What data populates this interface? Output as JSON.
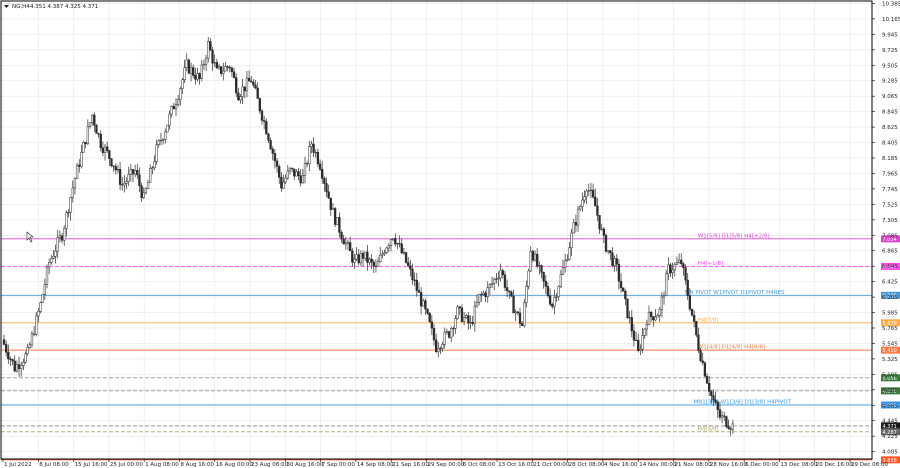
{
  "header": {
    "symbol": "NG,H4",
    "ohlc": "4.351 4.387 4.325 4.371"
  },
  "colors": {
    "candle": "#2b2b2b",
    "grid": "#e6e6e6",
    "frame": "#000000",
    "price_tag": "#1a1a1a"
  },
  "chart_data": {
    "type": "candlestick",
    "title": "",
    "ylim": [
      3.9,
      10.42
    ],
    "grid": true,
    "yticks": [
      "10.385",
      "10.165",
      "9.945",
      "9.725",
      "9.505",
      "9.285",
      "9.065",
      "8.845",
      "8.625",
      "8.405",
      "8.185",
      "7.965",
      "7.745",
      "7.525",
      "7.305",
      "7.085",
      "6.865",
      "6.645",
      "6.425",
      "6.205",
      "5.985",
      "5.765",
      "5.545",
      "5.325",
      "5.105",
      "4.885",
      "4.665",
      "4.445",
      "4.225",
      "4.005"
    ],
    "xticks": [
      "1 Jul 2022",
      "8 Jul 08:00",
      "15 Jul 16:00",
      "25 Jul 00:00",
      "1 Aug 08:00",
      "8 Aug 16:00",
      "16 Aug 00:00",
      "23 Aug 08:00",
      "30 Aug 16:00",
      "7 Sep 00:00",
      "14 Sep 08:00",
      "21 Sep 16:00",
      "29 Sep 00:00",
      "6 Oct 08:00",
      "13 Oct 16:00",
      "21 Oct 00:00",
      "28 Oct 08:00",
      "4 Nov 16:00",
      "14 Nov 00:00",
      "21 Nov 08:00",
      "28 Nov 16:00",
      "6 Dec 00:00",
      "13 Dec 08:00",
      "20 Dec 16:00",
      "29 Dec 08:00"
    ],
    "close_path": [
      [
        0,
        5.6
      ],
      [
        3,
        5.2
      ],
      [
        6,
        5.4
      ],
      [
        9,
        6.1
      ],
      [
        11,
        6.7
      ],
      [
        14,
        7.1
      ],
      [
        17,
        7.9
      ],
      [
        21,
        8.8
      ],
      [
        23,
        8.4
      ],
      [
        26,
        8.1
      ],
      [
        28,
        7.8
      ],
      [
        31,
        8.0
      ],
      [
        33,
        7.6
      ],
      [
        36,
        8.3
      ],
      [
        38,
        8.6
      ],
      [
        41,
        9.1
      ],
      [
        43,
        9.5
      ],
      [
        46,
        9.3
      ],
      [
        48,
        9.8
      ],
      [
        50,
        9.4
      ],
      [
        53,
        9.5
      ],
      [
        55,
        9.1
      ],
      [
        58,
        9.3
      ],
      [
        60,
        8.9
      ],
      [
        62,
        8.5
      ],
      [
        65,
        7.8
      ],
      [
        67,
        8.0
      ],
      [
        70,
        7.9
      ],
      [
        72,
        8.4
      ],
      [
        74,
        8.1
      ],
      [
        77,
        7.4
      ],
      [
        79,
        7.1
      ],
      [
        82,
        6.7
      ],
      [
        84,
        6.8
      ],
      [
        87,
        6.6
      ],
      [
        89,
        6.9
      ],
      [
        91,
        7.1
      ],
      [
        94,
        6.7
      ],
      [
        96,
        6.4
      ],
      [
        99,
        5.9
      ],
      [
        101,
        5.5
      ],
      [
        104,
        5.7
      ],
      [
        106,
        6.0
      ],
      [
        109,
        5.8
      ],
      [
        111,
        6.2
      ],
      [
        113,
        6.3
      ],
      [
        116,
        6.6
      ],
      [
        118,
        6.2
      ],
      [
        121,
        5.8
      ],
      [
        123,
        6.9
      ],
      [
        126,
        6.4
      ],
      [
        128,
        6.1
      ],
      [
        131,
        6.7
      ],
      [
        133,
        7.2
      ],
      [
        136,
        7.8
      ],
      [
        138,
        7.5
      ],
      [
        140,
        7.0
      ],
      [
        143,
        6.6
      ],
      [
        145,
        6.1
      ],
      [
        148,
        5.4
      ],
      [
        150,
        5.9
      ],
      [
        153,
        6.0
      ],
      [
        155,
        6.6
      ],
      [
        158,
        6.7
      ],
      [
        160,
        6.1
      ],
      [
        162,
        5.5
      ],
      [
        165,
        4.8
      ],
      [
        167,
        4.5
      ],
      [
        170,
        4.37
      ]
    ],
    "levels": [
      {
        "label": "W1[5/8] D1[5/8] H4[+2/8]",
        "price": "7.034",
        "value": 7.034,
        "color": "#dd44cc",
        "dash": false,
        "label_x": 0.8
      },
      {
        "label": "H4[+1/8]",
        "price": "6.641",
        "value": 6.641,
        "color": "#ff44ee",
        "dash": true,
        "label_x": 0.8
      },
      {
        "label": "MN PIVOT W1PIVOT D1PIVOT H4RES",
        "price": "6.230",
        "value": 6.23,
        "color": "#4499dd",
        "dash": false,
        "label_x": 0.785
      },
      {
        "label": "H4[7/8]",
        "price": "5.839",
        "value": 5.839,
        "color": "#ffaa44",
        "dash": false,
        "label_x": 0.8
      },
      {
        "label": "W1[4/8] D1[4/8] H4[6/8]",
        "price": "5.450",
        "value": 5.45,
        "color": "#ff7744",
        "dash": false,
        "label_x": 0.8
      },
      {
        "label": "",
        "price": "5.056",
        "value": 5.056,
        "color": "#999999",
        "dash": true,
        "label_x": 0
      },
      {
        "label": "",
        "price": "4.870",
        "value": 4.87,
        "color": "#999999",
        "dash": true,
        "label_x": 0
      },
      {
        "label": "MN1[3/8] W1[3/8] D1[3/8] H4PIVOT",
        "price": "4.669",
        "value": 4.669,
        "color": "#3399ee",
        "dash": false,
        "label_x": 0.795
      },
      {
        "label": "",
        "price": "4.371",
        "value": 4.371,
        "color": "#888888",
        "dash": true,
        "label_x": 0
      },
      {
        "label": "H4[5/8]",
        "price": "4.287",
        "value": 4.287,
        "color": "#aaaa66",
        "dash": true,
        "label_x": 0.8
      },
      {
        "label": "",
        "price": "3.888",
        "value": 3.888,
        "color": "#ff5522",
        "dash": false,
        "label_x": 0
      }
    ],
    "price_tags": [
      {
        "value": 7.034,
        "text": "7.034",
        "color": "#dd44cc"
      },
      {
        "value": 6.641,
        "text": "6.641",
        "color": "#ff44ee"
      },
      {
        "value": 6.23,
        "text": "6.230",
        "color": "#4499dd"
      },
      {
        "value": 5.839,
        "text": "5.839",
        "color": "#ffaa44"
      },
      {
        "value": 5.45,
        "text": "5.450",
        "color": "#ff7744"
      },
      {
        "value": 5.056,
        "text": "5.056",
        "color": "#3a7a3a"
      },
      {
        "value": 4.87,
        "text": "4.870",
        "color": "#3a7a3a"
      },
      {
        "value": 4.669,
        "text": "4.669",
        "color": "#3399ee"
      },
      {
        "value": 4.371,
        "text": "4.371",
        "color": "#1a1a1a"
      },
      {
        "value": 4.287,
        "text": "4.287",
        "color": "#666666"
      },
      {
        "value": 3.888,
        "text": "3.888",
        "color": "#ff5522"
      }
    ]
  }
}
